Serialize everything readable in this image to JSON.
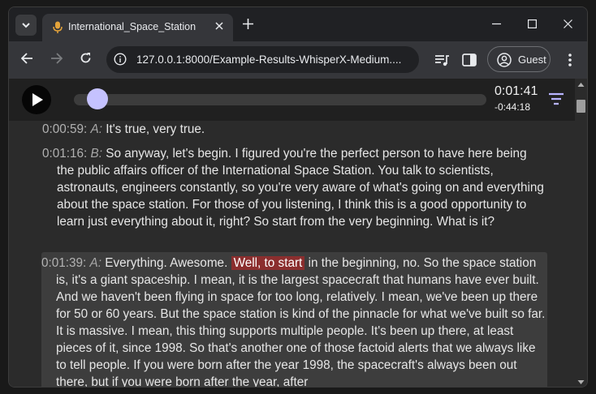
{
  "browser": {
    "tab_title": "International_Space_Station",
    "url": "127.0.0.1:8000/Example-Results-WhisperX-Medium....",
    "profile_label": "Guest"
  },
  "player": {
    "current_time": "0:01:41",
    "remaining_time": "-0:44:18"
  },
  "transcript": [
    {
      "timestamp": "0:00:59:",
      "speaker": "A:",
      "text": "It's true, very true."
    },
    {
      "timestamp": "0:01:16:",
      "speaker": "B:",
      "text": "So anyway, let's begin. I figured you're the perfect person to have here being the public affairs officer of the International Space Station. You talk to scientists, astronauts, engineers constantly, so you're very aware of what's going on and everything about the space station. For those of you listening, I think this is a good opportunity to learn just everything about it, right? So start from the very beginning. What is it?"
    },
    {
      "timestamp": "0:01:39:",
      "speaker": "A:",
      "text_before": "Everything. Awesome.",
      "highlight": "Well, to start",
      "text_after": "in the beginning, no. So the space station is, it's a giant spaceship. I mean, it is the largest spacecraft that humans have ever built. And we haven't been flying in space for too long, relatively. I mean, we've been up there for 50 or 60 years. But the space station is kind of the pinnacle for what we've built so far. It is massive. I mean, this thing supports multiple people. It's been up there, at least pieces of it, since 1998. So that's another one of those factoid alerts that we always like to tell people. If you were born after the year 1998, the spacecraft's always been out there, but if you were born after the year, after"
    }
  ]
}
